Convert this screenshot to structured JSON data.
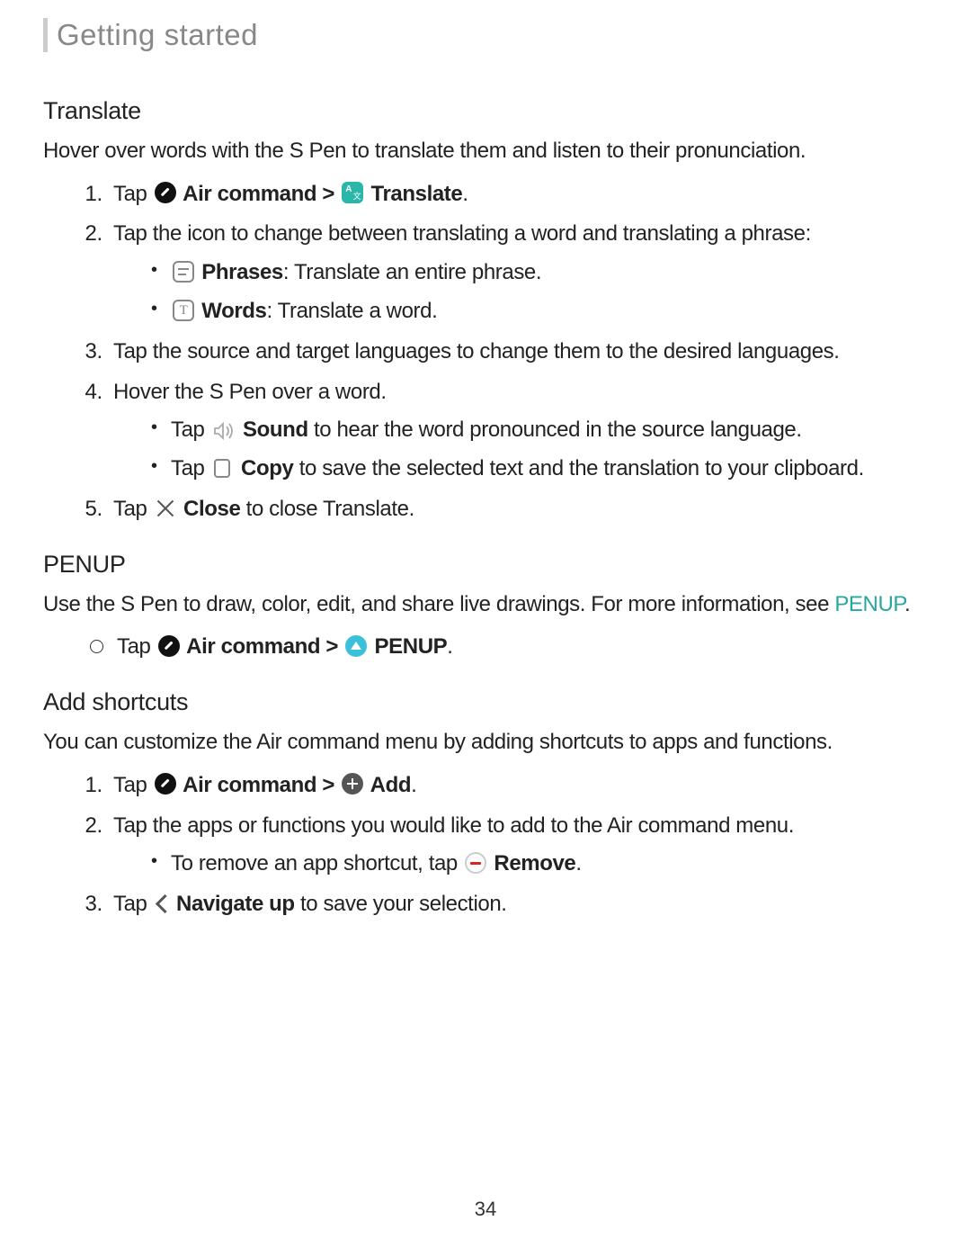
{
  "header": {
    "title": "Getting started"
  },
  "translate": {
    "title": "Translate",
    "intro": "Hover over words with the S Pen to translate them and listen to their pronunciation.",
    "step1_tap": "Tap",
    "step1_aircommand": " Air command > ",
    "step1_translate": " Translate",
    "step1_end": ".",
    "step2": "Tap the icon to change between translating a word and translating a phrase:",
    "phrases_label": "Phrases",
    "phrases_desc": ": Translate an entire phrase.",
    "words_label": "Words",
    "words_desc": ": Translate a word.",
    "step3": "Tap the source and target languages to change them to the desired languages.",
    "step4": "Hover the S Pen over a word.",
    "sound_tap": "Tap",
    "sound_label": " Sound",
    "sound_desc": " to hear the word pronounced in the source language.",
    "copy_tap": "Tap",
    "copy_label": " Copy",
    "copy_desc": " to save the selected text and the translation to your clipboard.",
    "step5_tap": "Tap",
    "step5_close": " Close",
    "step5_desc": " to close Translate."
  },
  "penup": {
    "title": "PENUP",
    "intro_a": "Use the S Pen to draw, color, edit, and share live drawings. For more information, see ",
    "link": "PENUP",
    "intro_b": ".",
    "tap": "Tap",
    "aircommand": " Air command > ",
    "penup_label": " PENUP",
    "end": "."
  },
  "shortcuts": {
    "title": "Add shortcuts",
    "intro": "You can customize the Air command menu by adding shortcuts to apps and functions.",
    "step1_tap": "Tap",
    "step1_aircommand": " Air command > ",
    "step1_add": " Add",
    "step1_end": ".",
    "step2": "Tap the apps or functions you would like to add to the Air command menu.",
    "remove_intro": "To remove an app shortcut, tap ",
    "remove_label": " Remove",
    "remove_end": ".",
    "step3_tap": "Tap",
    "step3_nav": " Navigate up",
    "step3_desc": " to save your selection."
  },
  "page_number": "34"
}
